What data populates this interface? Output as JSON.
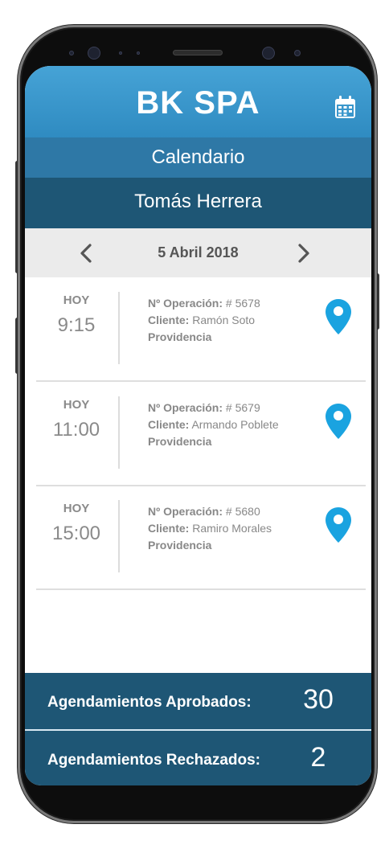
{
  "app": {
    "brand": "BK SPA"
  },
  "header": {
    "section_title": "Calendario",
    "user_name": "Tomás Herrera"
  },
  "date_nav": {
    "date": "5 Abril 2018"
  },
  "labels": {
    "operation": "Nº Operación:",
    "client": "Cliente:"
  },
  "appointments": [
    {
      "day": "HOY",
      "time": "9:15",
      "operation": "# 5678",
      "client": "Ramón Soto",
      "location": "Providencia"
    },
    {
      "day": "HOY",
      "time": "11:00",
      "operation": "# 5679",
      "client": "Armando Poblete",
      "location": "Providencia"
    },
    {
      "day": "HOY",
      "time": "15:00",
      "operation": "# 5680",
      "client": "Ramiro Morales",
      "location": "Providencia"
    }
  ],
  "summary": {
    "approved_label": "Agendamientos Aprobados:",
    "approved_count": "30",
    "rejected_label": "Agendamientos Rechazados:",
    "rejected_count": "2"
  },
  "icons": {
    "calendar": "calendar-icon",
    "prev": "chevron-left-icon",
    "next": "chevron-right-icon",
    "location": "map-pin-icon"
  },
  "colors": {
    "primary": "#3a97cc",
    "mid": "#2e78a6",
    "dark": "#1e5675",
    "pin": "#1aa3e0"
  }
}
